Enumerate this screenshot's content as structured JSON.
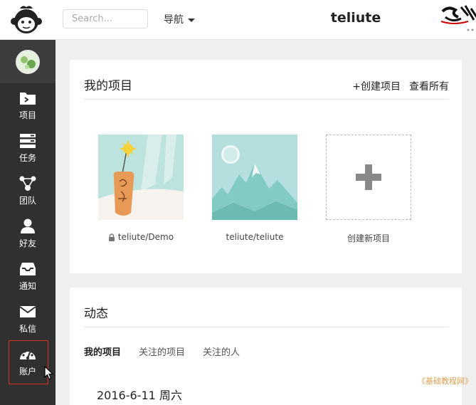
{
  "header": {
    "search_placeholder": "Search...",
    "nav_label": "导航",
    "site_title": "teliute"
  },
  "sidebar": {
    "items": [
      {
        "label": "项目",
        "icon": "folder-icon"
      },
      {
        "label": "任务",
        "icon": "tasks-icon"
      },
      {
        "label": "团队",
        "icon": "team-icon"
      },
      {
        "label": "好友",
        "icon": "user-icon"
      },
      {
        "label": "通知",
        "icon": "inbox-icon"
      },
      {
        "label": "私信",
        "icon": "mail-icon"
      },
      {
        "label": "账户",
        "icon": "dashboard-icon"
      }
    ]
  },
  "projects_card": {
    "title": "我的项目",
    "create_label": "+创建项目",
    "view_all_label": "查看所有",
    "projects": [
      {
        "name": "teliute/Demo",
        "private": true
      },
      {
        "name": "teliute/teliute",
        "private": false
      }
    ],
    "new_project_label": "创建新项目"
  },
  "activity_card": {
    "title": "动态",
    "tabs": [
      "我的项目",
      "关注的项目",
      "关注的人"
    ],
    "active_tab": 0,
    "date": "2016-6-11 周六"
  },
  "watermark": "《基础教程网》",
  "colors": {
    "sidebar_bg": "#303030",
    "highlight_border": "#d93025"
  }
}
